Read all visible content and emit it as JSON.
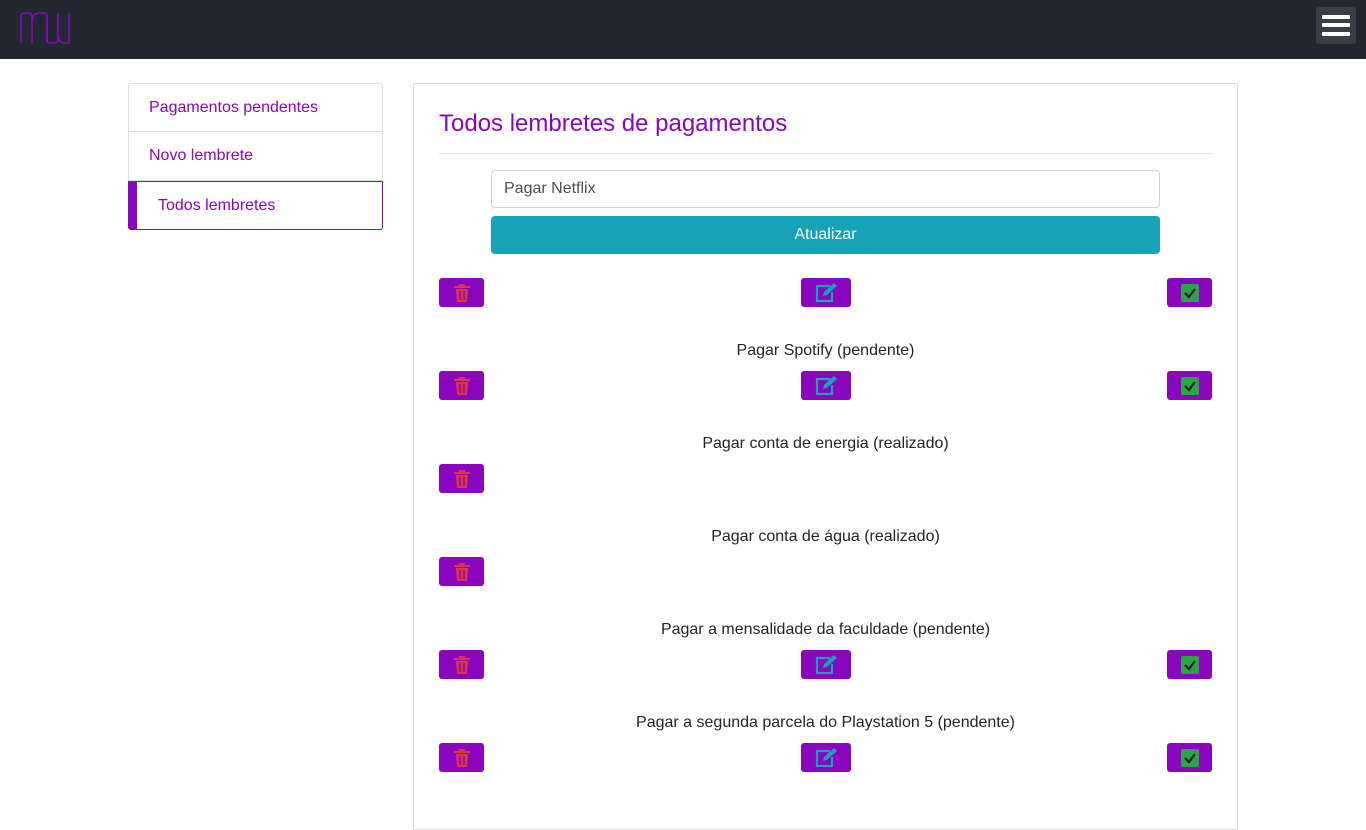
{
  "navbar": {
    "logo_icon": "nu-logo-icon",
    "menu_icon": "hamburger-menu-icon"
  },
  "sidebar": {
    "items": [
      {
        "label": "Pagamentos pendentes"
      },
      {
        "label": "Novo lembrete"
      },
      {
        "label": "Todos lembretes",
        "active": true
      }
    ]
  },
  "main": {
    "title": "Todos lembretes de pagamentos",
    "edit_form": {
      "input_value": "Pagar Netflix",
      "button_label": "Atualizar"
    },
    "reminders": [
      {
        "text": "Pagar Spotify (pendente)"
      },
      {
        "text": "Pagar conta de energia (realizado)"
      },
      {
        "text": "Pagar conta de água (realizado)"
      },
      {
        "text": "Pagar a mensalidade da faculdade (pendente)"
      },
      {
        "text": "Pagar a segunda parcela do Playstation 5 (pendente)"
      }
    ]
  },
  "colors": {
    "brand": "#8a05be",
    "navbar": "#23272f",
    "update_button": "#17a2b8",
    "trash_icon": "#dc3545",
    "edit_icon": "#17a2b8",
    "check_icon": "#28a745"
  }
}
